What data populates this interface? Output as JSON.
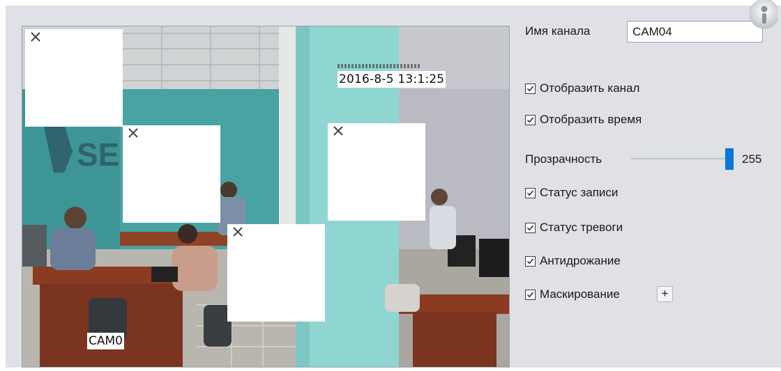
{
  "preview": {
    "osd_time": "2016-8-5 13:1:25",
    "osd_channel": "CAM0",
    "mask_icon": "close-icon"
  },
  "settings": {
    "channel_name_label": "Имя канала",
    "channel_name_value": "CAM04",
    "show_channel_label": "Отобразить канал",
    "show_channel_checked": true,
    "show_time_label": "Отобразить время",
    "show_time_checked": true,
    "transparency_label": "Прозрачность",
    "transparency_value": "255",
    "transparency_max": 255,
    "record_status_label": "Статус записи",
    "record_status_checked": true,
    "alarm_status_label": "Статус тревоги",
    "alarm_status_checked": true,
    "antishake_label": "Антидрожание",
    "antishake_checked": true,
    "masking_label": "Маскирование",
    "masking_checked": true,
    "add_mask_label": "+"
  },
  "colors": {
    "panel_bg": "#dfe1e6",
    "accent": "#0a77d8"
  },
  "icons": {
    "help": "help-icon",
    "checkbox": "checkbox-checked-icon"
  }
}
